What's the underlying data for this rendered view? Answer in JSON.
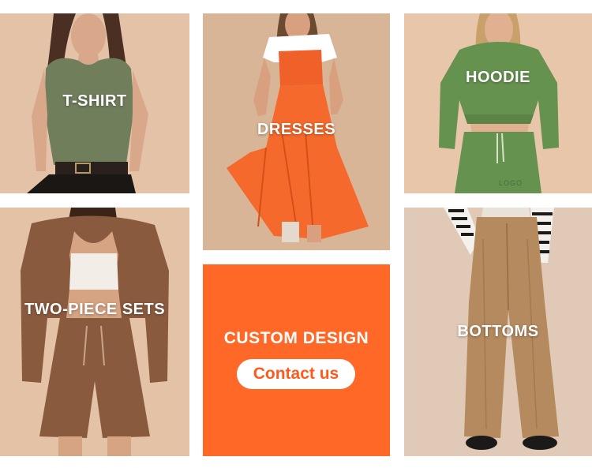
{
  "categories": {
    "tshirt": {
      "label": "T-SHIRT"
    },
    "dresses": {
      "label": "DRESSES"
    },
    "hoodie": {
      "label": "HOODIE",
      "print_text": "LOGO"
    },
    "sets": {
      "label": "TWO-PIECE SETS"
    },
    "bottoms": {
      "label": "BOTTOMS"
    }
  },
  "custom": {
    "title": "CUSTOM DESIGN",
    "button_label": "Contact us",
    "accent_color": "#ff6826"
  }
}
